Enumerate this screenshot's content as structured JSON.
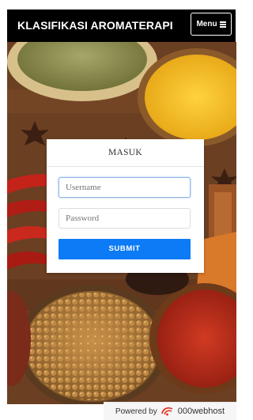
{
  "navbar": {
    "brand": "KLASIFIKASI AROMATERAPI",
    "menu_label": "Menu"
  },
  "login": {
    "title": "MASUK",
    "username_placeholder": "Username",
    "password_placeholder": "Password",
    "submit_label": "SUBMIT"
  },
  "footer": {
    "powered_by": "Powered by",
    "host_name": "000webhost"
  },
  "colors": {
    "navbar": "#000000",
    "submit": "#0d7bf5",
    "turmeric": "#f2b51c",
    "paprika": "#c0301c",
    "herbs": "#8a8a45"
  },
  "icons": {
    "menu": "hamburger-icon",
    "host_logo": "webhost-logo-icon"
  }
}
